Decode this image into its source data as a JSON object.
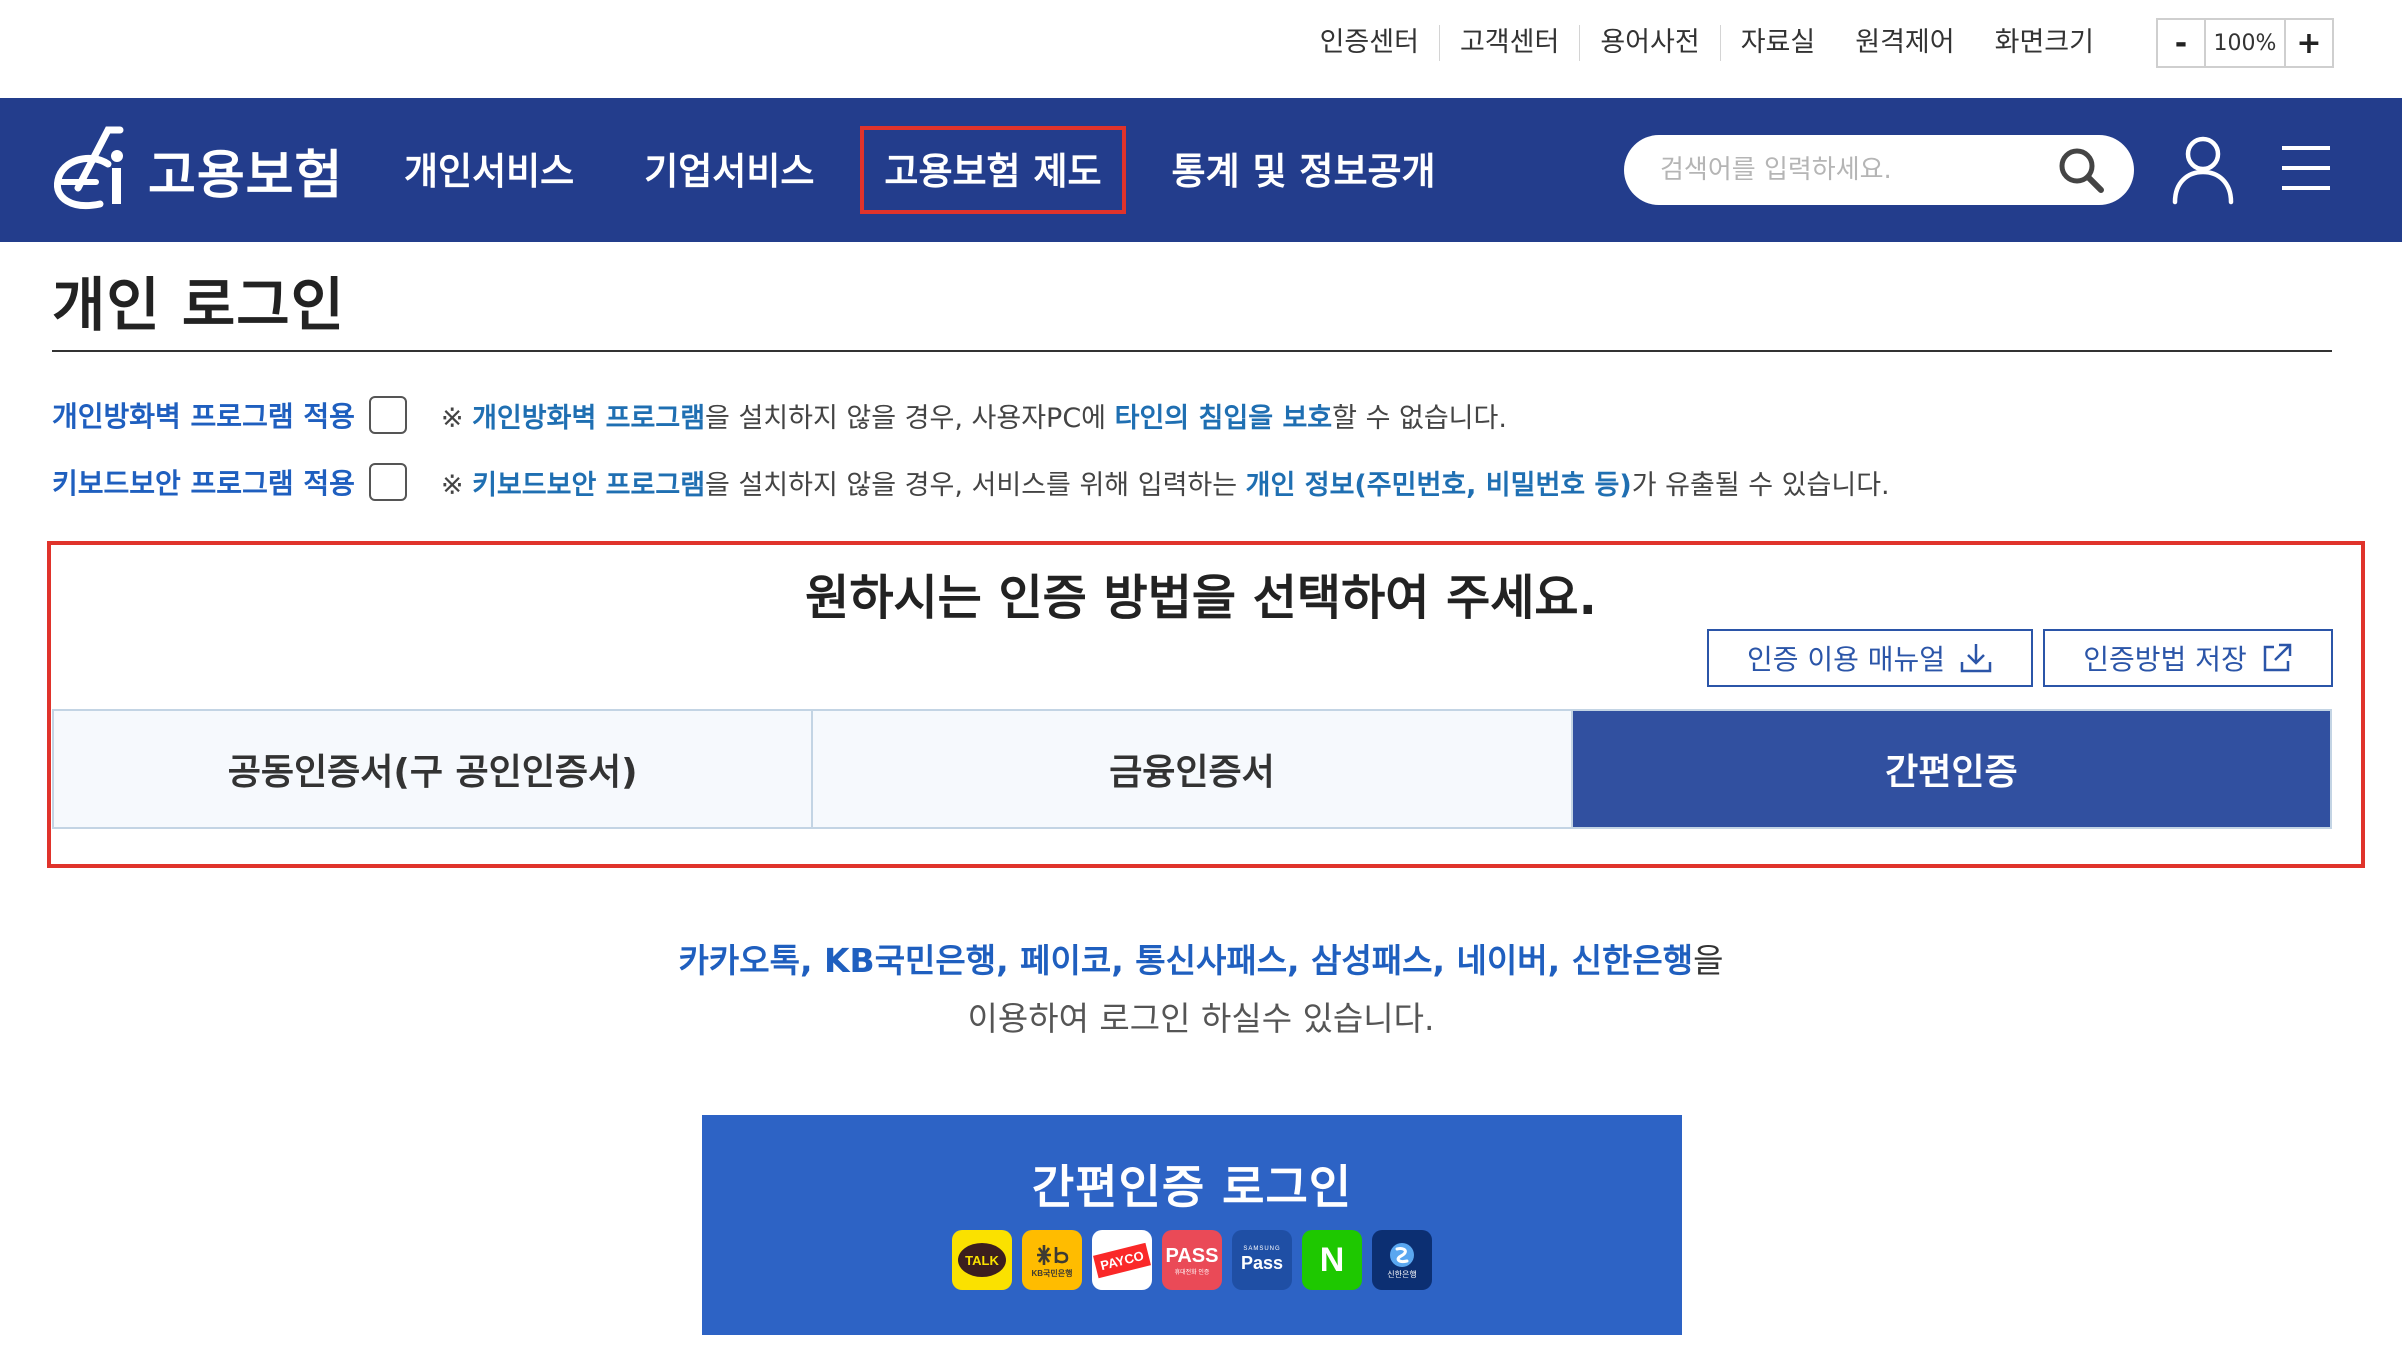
{
  "util": {
    "links": [
      "인증센터",
      "고객센터",
      "용어사전",
      "자료실",
      "원격제어"
    ],
    "zoom_label": "화면크기",
    "zoom_minus": "-",
    "zoom_value": "100%",
    "zoom_plus": "+"
  },
  "nav": {
    "logo_text": "고용보험",
    "items": [
      "개인서비스",
      "기업서비스",
      "고용보험 제도",
      "통계 및 정보공개"
    ],
    "search_placeholder": "검색어를 입력하세요."
  },
  "page": {
    "title": "개인 로그인"
  },
  "options": {
    "firewall": {
      "label": "개인방화벽 프로그램 적용",
      "checked": false,
      "note_prefix": "※ ",
      "note_em1": "개인방화벽 프로그램",
      "note_mid": "을 설치하지 않을 경우, 사용자PC에 ",
      "note_em2": "타인의 침입을 보호",
      "note_suffix": "할 수 없습니다."
    },
    "keyboard": {
      "label": "키보드보안 프로그램 적용",
      "checked": false,
      "note_prefix": "※ ",
      "note_em1": "키보드보안 프로그램",
      "note_mid": "을 설치하지 않을 경우, 서비스를 위해 입력하는 ",
      "note_em2": "개인 정보(주민번호, 비밀번호 등)",
      "note_suffix": "가 유출될 수 있습니다."
    }
  },
  "auth": {
    "heading": "원하시는 인증 방법을 선택하여 주세요.",
    "manual_button": "인증 이용 매뉴얼",
    "save_button": "인증방법 저장",
    "tabs": [
      "공동인증서(구 공인인증서)",
      "금융인증서",
      "간편인증"
    ],
    "active_tab": "간편인증",
    "desc_em": "카카오톡, KB국민은행, 페이코, 통신사패스, 삼성패스, 네이버, 신한은행",
    "desc_suffix": "을",
    "desc_line2": "이용하여 로그인 하실수 있습니다.",
    "easy_login_label": "간편인증 로그인"
  },
  "providers": {
    "kakao": "TALK",
    "kb_sub": "KB국민은행",
    "payco": "PAYCO",
    "pass": "PASS",
    "pass_sub": "휴대전화 인증",
    "samsung_top": "SAMSUNG",
    "samsung": "Pass",
    "naver": "N",
    "shinhan": "신한은행"
  },
  "colors": {
    "nav_bg": "#233d8c",
    "highlight": "#e0332b",
    "active_tab": "#3150a0",
    "easy_login_bg": "#2d63c5",
    "link_blue": "#1f5fbf"
  }
}
